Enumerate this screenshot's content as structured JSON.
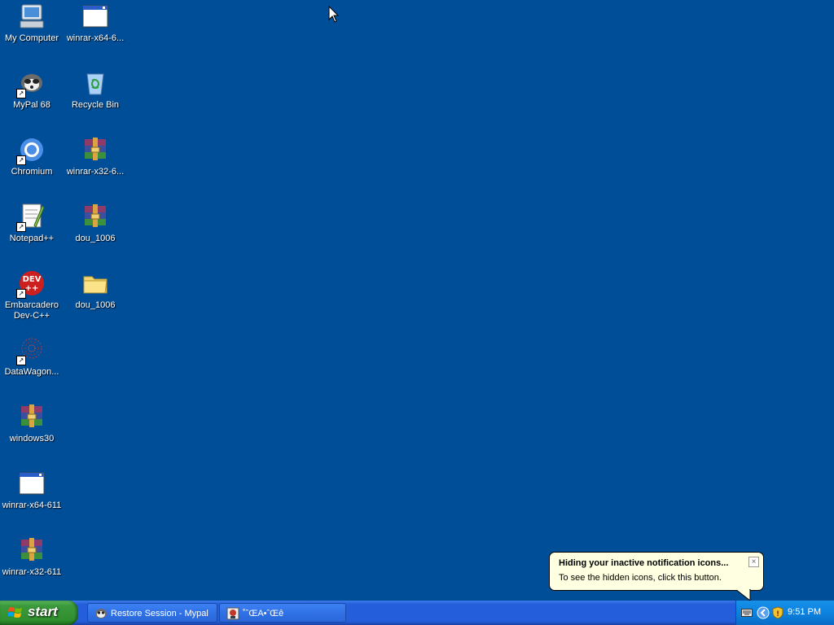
{
  "desktop": {
    "icons": [
      {
        "label": "My Computer",
        "icon": "my-computer-icon"
      },
      {
        "label": "winrar-x64-6...",
        "icon": "window-app-icon"
      },
      {
        "label": "MyPal 68",
        "icon": "raccoon-icon"
      },
      {
        "label": "Recycle Bin",
        "icon": "recycle-bin-icon"
      },
      {
        "label": "Chromium",
        "icon": "chromium-icon"
      },
      {
        "label": "winrar-x32-6...",
        "icon": "winrar-archive-icon"
      },
      {
        "label": "Notepad++",
        "icon": "notepad-plus-plus-icon"
      },
      {
        "label": "dou_1006",
        "icon": "winrar-archive-icon"
      },
      {
        "label": "Embarcadero Dev-C++",
        "icon": "dev-cpp-icon"
      },
      {
        "label": "dou_1006",
        "icon": "folder-icon"
      },
      {
        "label": "DataWagon...",
        "icon": "datawagon-icon"
      },
      {
        "label": "windows30",
        "icon": "winrar-archive-icon"
      },
      {
        "label": "winrar-x64-611",
        "icon": "window-app-icon"
      },
      {
        "label": "winrar-x32-611",
        "icon": "winrar-archive-icon"
      }
    ]
  },
  "taskbar": {
    "start_label": "start",
    "tasks": [
      {
        "label": "Restore Session - Mypal",
        "icon": "raccoon-icon"
      },
      {
        "label": "˚ˆŒA•ˆŒê",
        "icon": "app-icon"
      }
    ],
    "clock": "9:51 PM"
  },
  "balloon": {
    "title": "Hiding your inactive notification icons...",
    "text": "To see the hidden icons, click this button.",
    "close_glyph": "×"
  },
  "colors": {
    "desktop_bg": "#004e98",
    "taskbar_blue": "#245edb",
    "start_green": "#3c9a3c",
    "balloon_bg": "#ffffe1"
  }
}
